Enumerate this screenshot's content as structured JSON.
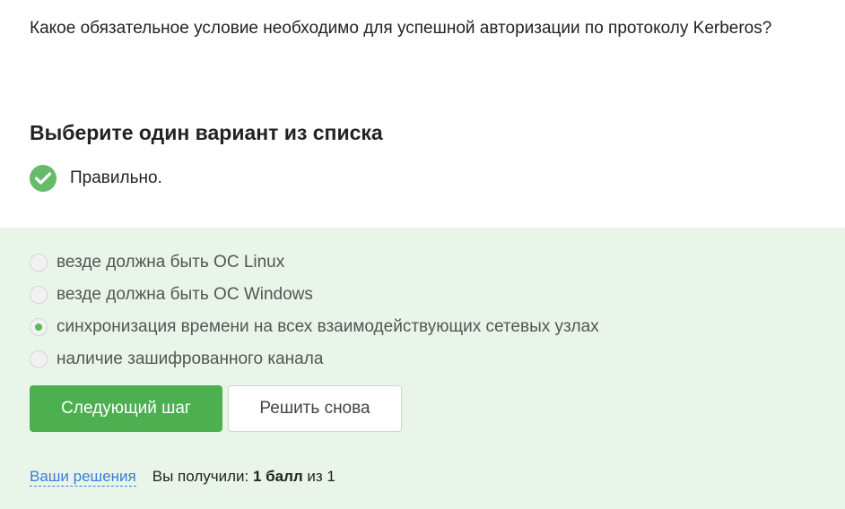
{
  "question": "Какое обязательное условие необходимо для успешной авторизации по протоколу Kerberos?",
  "instruction": "Выберите один вариант из списка",
  "result": {
    "text": "Правильно.",
    "icon": "check-circle-icon",
    "color": "#66bb6a"
  },
  "options": [
    {
      "label": "везде должна быть ОС Linux",
      "selected": false
    },
    {
      "label": "везде должна быть ОС Windows",
      "selected": false
    },
    {
      "label": "синхронизация времени на всех взаимодействующих сетевых узлах",
      "selected": true
    },
    {
      "label": "наличие зашифрованного канала",
      "selected": false
    }
  ],
  "buttons": {
    "next": "Следующий шаг",
    "retry": "Решить снова"
  },
  "footer": {
    "solutions_link": "Ваши решения",
    "score_prefix": "Вы получили: ",
    "score_value": "1 балл",
    "score_suffix": " из 1"
  },
  "colors": {
    "panel_bg": "#e9f5e9",
    "accent": "#4caf50",
    "link": "#3b7dd8"
  }
}
